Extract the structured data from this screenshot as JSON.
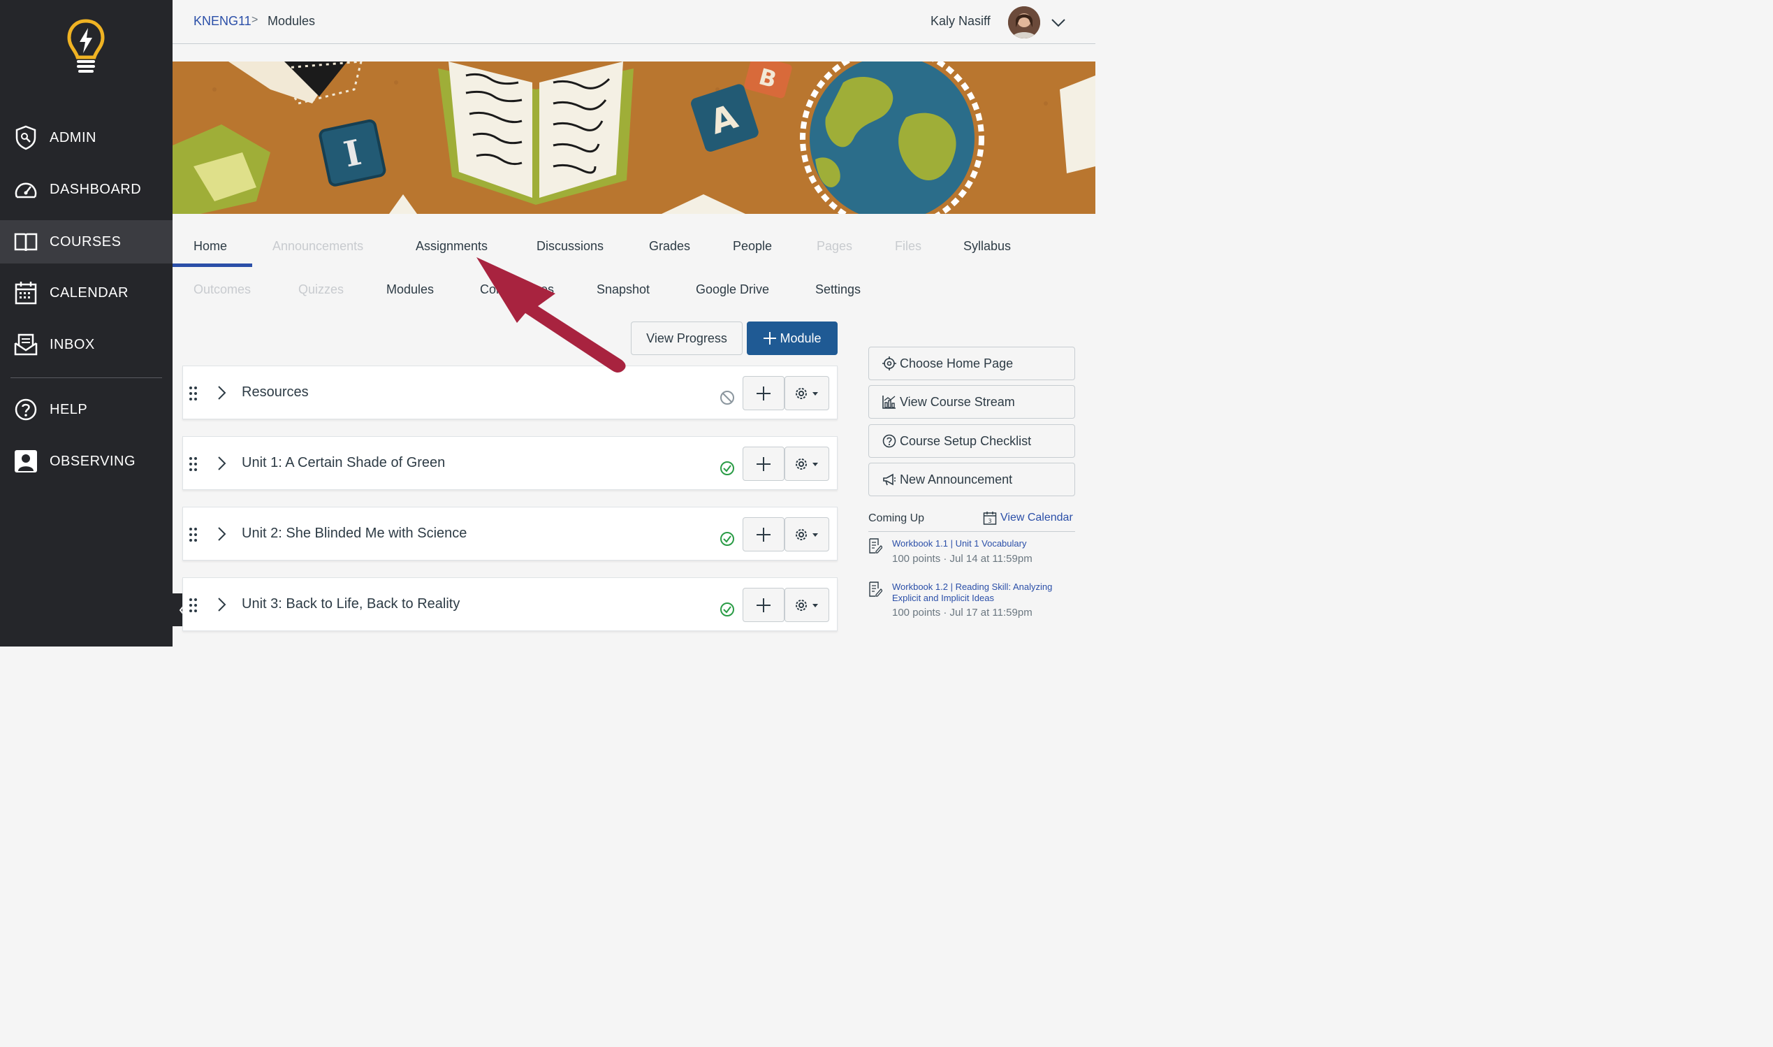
{
  "sidebar": {
    "items": [
      {
        "label": "ADMIN",
        "icon": "admin-shield-icon"
      },
      {
        "label": "DASHBOARD",
        "icon": "speedometer-icon"
      },
      {
        "label": "COURSES",
        "icon": "book-icon"
      },
      {
        "label": "CALENDAR",
        "icon": "calendar-icon"
      },
      {
        "label": "INBOX",
        "icon": "inbox-icon"
      },
      {
        "label": "HELP",
        "icon": "help-icon"
      },
      {
        "label": "OBSERVING",
        "icon": "person-icon"
      }
    ],
    "active": "COURSES"
  },
  "breadcrumb": {
    "course": "KNENG11",
    "separator": ">",
    "current": "Modules"
  },
  "user": {
    "name": "Kaly Nasiff"
  },
  "course_nav": {
    "row1": [
      {
        "label": "Home",
        "enabled": true
      },
      {
        "label": "Announcements",
        "enabled": false
      },
      {
        "label": "Assignments",
        "enabled": true
      },
      {
        "label": "Discussions",
        "enabled": true
      },
      {
        "label": "Grades",
        "enabled": true
      },
      {
        "label": "People",
        "enabled": true
      },
      {
        "label": "Pages",
        "enabled": false
      },
      {
        "label": "Files",
        "enabled": false
      },
      {
        "label": "Syllabus",
        "enabled": true
      }
    ],
    "row2": [
      {
        "label": "Outcomes",
        "enabled": false
      },
      {
        "label": "Quizzes",
        "enabled": false
      },
      {
        "label": "Modules",
        "enabled": true
      },
      {
        "label": "Con",
        "enabled": true
      },
      {
        "label": "es",
        "enabled": true
      },
      {
        "label": "Snapshot",
        "enabled": true
      },
      {
        "label": "Google Drive",
        "enabled": true
      },
      {
        "label": "Settings",
        "enabled": true
      }
    ]
  },
  "toolbar": {
    "view_progress": "View Progress",
    "add_module": "Module"
  },
  "modules": [
    {
      "title": "Resources",
      "published": false
    },
    {
      "title": "Unit 1: A Certain Shade of Green",
      "published": true
    },
    {
      "title": "Unit 2: She Blinded Me with Science",
      "published": true
    },
    {
      "title": "Unit 3: Back to Life, Back to Reality",
      "published": true
    }
  ],
  "right_panel": {
    "buttons": [
      {
        "label": "Choose Home Page",
        "icon": "target-icon"
      },
      {
        "label": "View Course Stream",
        "icon": "stream-chart-icon"
      },
      {
        "label": "Course Setup Checklist",
        "icon": "question-circle-icon"
      },
      {
        "label": "New Announcement",
        "icon": "megaphone-icon"
      }
    ],
    "coming_up": {
      "title": "Coming Up",
      "view_calendar": "View Calendar",
      "items": [
        {
          "title": "Workbook 1.1 | Unit 1 Vocabulary",
          "meta": "100 points · Jul 14 at 11:59pm"
        },
        {
          "title": "Workbook 1.2 | Reading Skill: Analyzing Explicit and Implicit Ideas",
          "meta": "100 points · Jul 17 at 11:59pm"
        }
      ]
    }
  },
  "colors": {
    "sidebar_bg": "#25262a",
    "primary": "#1f5a94",
    "link": "#2b4fa8",
    "arrow": "#a8233f",
    "logo": "#f0b323"
  }
}
